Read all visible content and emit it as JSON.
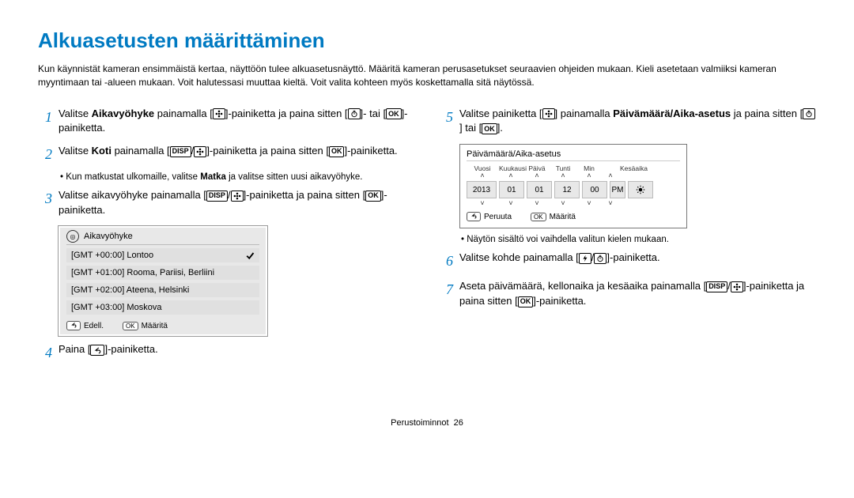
{
  "title": "Alkuasetusten määrittäminen",
  "intro": "Kun käynnistät kameran ensimmäistä kertaa, näyttöön tulee alkuasetusnäyttö. Määritä kameran perusasetukset seuraavien ohjeiden mukaan. Kieli asetetaan valmiiksi kameran myyntimaan tai -alueen mukaan. Voit halutessasi muuttaa kieltä. Voit valita kohteen myös koskettamalla sitä näytössä.",
  "steps": {
    "s1_a": "Valitse ",
    "s1_b": "Aikavyöhyke",
    "s1_c": " painamalla [",
    "s1_d": "]-painiketta ja paina sitten [",
    "s1_e": "]- tai [",
    "s1_f": "]-painiketta.",
    "s2_a": "Valitse ",
    "s2_b": "Koti",
    "s2_c": " painamalla [",
    "s2_d": "]-painiketta ja paina sitten [",
    "s2_e": "]-painiketta.",
    "s2_note_a": "Kun matkustat ulkomaille, valitse ",
    "s2_note_b": "Matka",
    "s2_note_c": " ja valitse sitten uusi aikavyöhyke.",
    "s3_a": "Valitse aikavyöhyke painamalla [",
    "s3_b": "]-painiketta ja paina sitten [",
    "s3_c": "]-painiketta.",
    "s4_a": "Paina [",
    "s4_b": "]-painiketta.",
    "s5_a": "Valitse painiketta [",
    "s5_b": "] painamalla ",
    "s5_c": "Päivämäärä/Aika-asetus",
    "s5_d": " ja paina sitten [",
    "s5_e": "] tai [",
    "s5_f": "].",
    "s5_note": "Näytön sisältö voi vaihdella valitun kielen mukaan.",
    "s6_a": "Valitse kohde painamalla [",
    "s6_b": "]-painiketta.",
    "s7_a": "Aseta päivämäärä, kellonaika ja kesäaika painamalla [",
    "s7_b": "]-painiketta ja paina sitten [",
    "s7_c": "]-painiketta."
  },
  "tz_panel": {
    "title": "Aikavyöhyke",
    "rows": [
      "[GMT +00:00] Lontoo",
      "[GMT +01:00] Rooma, Pariisi, Berliini",
      "[GMT +02:00] Ateena, Helsinki",
      "[GMT +03:00] Moskova"
    ],
    "back_label": "Edell.",
    "ok_label": "Määritä"
  },
  "dt_panel": {
    "title": "Päivämäärä/Aika-asetus",
    "labels": {
      "year": "Vuosi",
      "month": "Kuukausi",
      "day": "Päivä",
      "hour": "Tunti",
      "min": "Min",
      "dst": "Kesäaika"
    },
    "values": {
      "year": "2013",
      "month": "01",
      "day": "01",
      "hour": "12",
      "min": "00",
      "ampm": "PM"
    },
    "cancel_label": "Peruuta",
    "ok_label": "Määritä",
    "ok_btn": "OK"
  },
  "footer": {
    "section": "Perustoiminnot",
    "page": "26"
  },
  "icons": {
    "disp": "DISP",
    "ok": "OK"
  }
}
